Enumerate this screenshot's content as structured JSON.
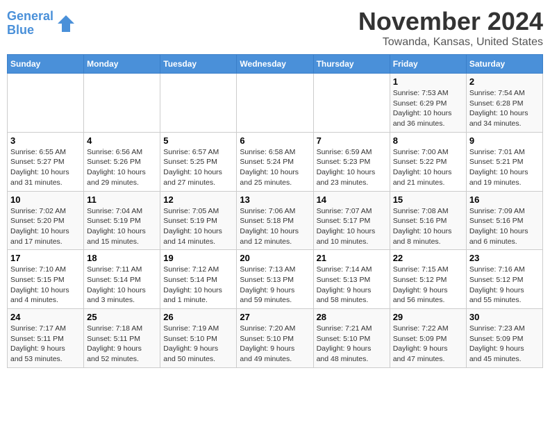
{
  "logo": {
    "line1": "General",
    "line2": "Blue"
  },
  "title": "November 2024",
  "location": "Towanda, Kansas, United States",
  "weekdays": [
    "Sunday",
    "Monday",
    "Tuesday",
    "Wednesday",
    "Thursday",
    "Friday",
    "Saturday"
  ],
  "weeks": [
    [
      {
        "day": "",
        "info": ""
      },
      {
        "day": "",
        "info": ""
      },
      {
        "day": "",
        "info": ""
      },
      {
        "day": "",
        "info": ""
      },
      {
        "day": "",
        "info": ""
      },
      {
        "day": "1",
        "info": "Sunrise: 7:53 AM\nSunset: 6:29 PM\nDaylight: 10 hours\nand 36 minutes."
      },
      {
        "day": "2",
        "info": "Sunrise: 7:54 AM\nSunset: 6:28 PM\nDaylight: 10 hours\nand 34 minutes."
      }
    ],
    [
      {
        "day": "3",
        "info": "Sunrise: 6:55 AM\nSunset: 5:27 PM\nDaylight: 10 hours\nand 31 minutes."
      },
      {
        "day": "4",
        "info": "Sunrise: 6:56 AM\nSunset: 5:26 PM\nDaylight: 10 hours\nand 29 minutes."
      },
      {
        "day": "5",
        "info": "Sunrise: 6:57 AM\nSunset: 5:25 PM\nDaylight: 10 hours\nand 27 minutes."
      },
      {
        "day": "6",
        "info": "Sunrise: 6:58 AM\nSunset: 5:24 PM\nDaylight: 10 hours\nand 25 minutes."
      },
      {
        "day": "7",
        "info": "Sunrise: 6:59 AM\nSunset: 5:23 PM\nDaylight: 10 hours\nand 23 minutes."
      },
      {
        "day": "8",
        "info": "Sunrise: 7:00 AM\nSunset: 5:22 PM\nDaylight: 10 hours\nand 21 minutes."
      },
      {
        "day": "9",
        "info": "Sunrise: 7:01 AM\nSunset: 5:21 PM\nDaylight: 10 hours\nand 19 minutes."
      }
    ],
    [
      {
        "day": "10",
        "info": "Sunrise: 7:02 AM\nSunset: 5:20 PM\nDaylight: 10 hours\nand 17 minutes."
      },
      {
        "day": "11",
        "info": "Sunrise: 7:04 AM\nSunset: 5:19 PM\nDaylight: 10 hours\nand 15 minutes."
      },
      {
        "day": "12",
        "info": "Sunrise: 7:05 AM\nSunset: 5:19 PM\nDaylight: 10 hours\nand 14 minutes."
      },
      {
        "day": "13",
        "info": "Sunrise: 7:06 AM\nSunset: 5:18 PM\nDaylight: 10 hours\nand 12 minutes."
      },
      {
        "day": "14",
        "info": "Sunrise: 7:07 AM\nSunset: 5:17 PM\nDaylight: 10 hours\nand 10 minutes."
      },
      {
        "day": "15",
        "info": "Sunrise: 7:08 AM\nSunset: 5:16 PM\nDaylight: 10 hours\nand 8 minutes."
      },
      {
        "day": "16",
        "info": "Sunrise: 7:09 AM\nSunset: 5:16 PM\nDaylight: 10 hours\nand 6 minutes."
      }
    ],
    [
      {
        "day": "17",
        "info": "Sunrise: 7:10 AM\nSunset: 5:15 PM\nDaylight: 10 hours\nand 4 minutes."
      },
      {
        "day": "18",
        "info": "Sunrise: 7:11 AM\nSunset: 5:14 PM\nDaylight: 10 hours\nand 3 minutes."
      },
      {
        "day": "19",
        "info": "Sunrise: 7:12 AM\nSunset: 5:14 PM\nDaylight: 10 hours\nand 1 minute."
      },
      {
        "day": "20",
        "info": "Sunrise: 7:13 AM\nSunset: 5:13 PM\nDaylight: 9 hours\nand 59 minutes."
      },
      {
        "day": "21",
        "info": "Sunrise: 7:14 AM\nSunset: 5:13 PM\nDaylight: 9 hours\nand 58 minutes."
      },
      {
        "day": "22",
        "info": "Sunrise: 7:15 AM\nSunset: 5:12 PM\nDaylight: 9 hours\nand 56 minutes."
      },
      {
        "day": "23",
        "info": "Sunrise: 7:16 AM\nSunset: 5:12 PM\nDaylight: 9 hours\nand 55 minutes."
      }
    ],
    [
      {
        "day": "24",
        "info": "Sunrise: 7:17 AM\nSunset: 5:11 PM\nDaylight: 9 hours\nand 53 minutes."
      },
      {
        "day": "25",
        "info": "Sunrise: 7:18 AM\nSunset: 5:11 PM\nDaylight: 9 hours\nand 52 minutes."
      },
      {
        "day": "26",
        "info": "Sunrise: 7:19 AM\nSunset: 5:10 PM\nDaylight: 9 hours\nand 50 minutes."
      },
      {
        "day": "27",
        "info": "Sunrise: 7:20 AM\nSunset: 5:10 PM\nDaylight: 9 hours\nand 49 minutes."
      },
      {
        "day": "28",
        "info": "Sunrise: 7:21 AM\nSunset: 5:10 PM\nDaylight: 9 hours\nand 48 minutes."
      },
      {
        "day": "29",
        "info": "Sunrise: 7:22 AM\nSunset: 5:09 PM\nDaylight: 9 hours\nand 47 minutes."
      },
      {
        "day": "30",
        "info": "Sunrise: 7:23 AM\nSunset: 5:09 PM\nDaylight: 9 hours\nand 45 minutes."
      }
    ]
  ]
}
